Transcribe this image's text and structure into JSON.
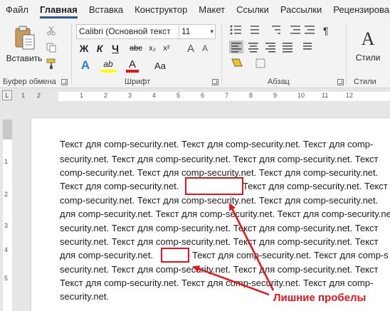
{
  "tabs": [
    "Файл",
    "Главная",
    "Вставка",
    "Конструктор",
    "Макет",
    "Ссылки",
    "Рассылки",
    "Рецензировани"
  ],
  "ribbon": {
    "clipboard": {
      "label": "Буфер обмена",
      "paste_label": "Вставить"
    },
    "font": {
      "label": "Шрифт",
      "font_name": "Calibri (Основной текст",
      "font_size": "11",
      "bold": "Ж",
      "italic": "К",
      "underline": "Ч",
      "strike": "abc",
      "subscript": "x₂",
      "superscript": "x²",
      "grow": "A",
      "shrink": "A",
      "case": "Aa",
      "effects": "A",
      "highlight": "ab",
      "color": "A"
    },
    "paragraph": {
      "label": "Абзац",
      "pilcrow": "¶"
    },
    "styles": {
      "label": "Стили",
      "styles_label": "Стили",
      "styles_icon": "A"
    }
  },
  "ruler": {
    "corner": "L",
    "numbers": [
      "1",
      "2",
      "1",
      "1",
      "2",
      "3",
      "4",
      "5",
      "6",
      "7",
      "8",
      "9",
      "10",
      "11",
      "12"
    ]
  },
  "vruler_numbers": [
    "1",
    "2",
    "3",
    "4",
    "5"
  ],
  "document": {
    "lines": [
      "Текст для comp-security.net. Текст для comp-security.net. Текст для comp-",
      "security.net. Текст для comp-security.net. Текст для comp-security.net. Текст",
      "comp-security.net. Текст для comp-security.net. Текст для comp-security.net.",
      "Текст для comp-security.net.",
      "comp-security.net. Текст для comp-security.net. Текст для comp-security.net.",
      "для comp-security.net. Текст для comp-security.net. Текст для comp-security.net.",
      "security.net. Текст для comp-security.net. Текст для comp-security.net. Текст",
      "security.net. Текст для comp-security.net. Текст для comp-security.net. Текст",
      "для comp-security.net.",
      "security.net. Текст для comp-security.net. Текст для comp-security.net. Текст",
      "Текст для comp-security.net. Текст для comp-security.net. Текст для comp-",
      "security.net."
    ],
    "line4_rest": "Текст для comp-security.net. Текст",
    "line9_rest": "Текст для comp-security.net. Текст для comp-s"
  },
  "annotation": "Лишние пробелы",
  "colors": {
    "accent": "#2b579a",
    "annotation": "#e8141c",
    "highlight": "#ffff00",
    "font_color": "#e8141c"
  }
}
